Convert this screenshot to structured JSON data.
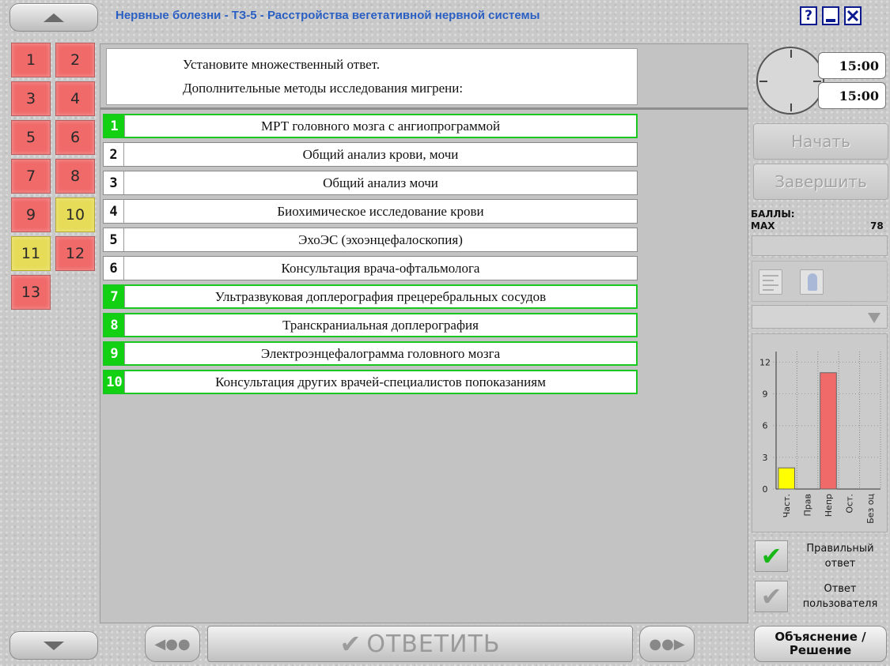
{
  "title": "Нервные болезни - ТЗ-5 - Расстройства вегетативной нервной системы",
  "window_controls": {
    "help": "?"
  },
  "questions": [
    {
      "label": "1",
      "status": "red"
    },
    {
      "label": "2",
      "status": "red"
    },
    {
      "label": "3",
      "status": "red"
    },
    {
      "label": "4",
      "status": "red"
    },
    {
      "label": "5",
      "status": "red"
    },
    {
      "label": "6",
      "status": "red"
    },
    {
      "label": "7",
      "status": "red"
    },
    {
      "label": "8",
      "status": "red"
    },
    {
      "label": "9",
      "status": "red"
    },
    {
      "label": "10",
      "status": "yellow"
    },
    {
      "label": "11",
      "status": "yellow"
    },
    {
      "label": "12",
      "status": "red"
    },
    {
      "label": "13",
      "status": "red"
    }
  ],
  "question": {
    "line1": "Установите множественный ответ.",
    "line2": "Дополнительные методы исследования мигрени:"
  },
  "answers": [
    {
      "num": "1",
      "text": "МРТ головного мозга с ангиопрограммой",
      "selected": true
    },
    {
      "num": "2",
      "text": "Общий анализ крови, мочи",
      "selected": false
    },
    {
      "num": "3",
      "text": "Общий анализ мочи",
      "selected": false
    },
    {
      "num": "4",
      "text": "Биохимическое исследование крови",
      "selected": false
    },
    {
      "num": "5",
      "text": "ЭхоЭС (эхоэнцефалоскопия)",
      "selected": false
    },
    {
      "num": "6",
      "text": "Консультация врача-офтальмолога",
      "selected": false
    },
    {
      "num": "7",
      "text": "Ультразвуковая доплерография прецеребральных сосудов",
      "selected": true
    },
    {
      "num": "8",
      "text": "Транскраниальная доплерография",
      "selected": true
    },
    {
      "num": "9",
      "text": "Электроэнцефалограмма головного мозга",
      "selected": true
    },
    {
      "num": "10",
      "text": "Консультация других врачей-специалистов попоказаниям",
      "selected": true
    }
  ],
  "timer": {
    "total": "15:00",
    "remaining": "15:00"
  },
  "buttons": {
    "start": "Начать",
    "finish": "Завершить",
    "answer": "ОТВЕТИТЬ",
    "explain_line1": "Объяснение /",
    "explain_line2": "Решение"
  },
  "score": {
    "label": "БАЛЛЫ:",
    "max_label": "MAX",
    "max_value": "78"
  },
  "legend": {
    "correct_line1": "Правильный",
    "correct_line2": "ответ",
    "user_line1": "Ответ",
    "user_line2": "пользователя"
  },
  "colors": {
    "answered_red": "#f06a6a",
    "partial_yellow": "#e6dc58",
    "selected_green": "#12d012",
    "title_blue": "#2a5fc4"
  },
  "chart_data": {
    "type": "bar",
    "categories": [
      "Част.",
      "Прав",
      "Непр",
      "Ост.",
      "Без оц"
    ],
    "values": [
      2,
      0,
      11,
      0,
      0
    ],
    "colors": [
      "#ffff00",
      "#d0d0d0",
      "#f06a6a",
      "#d0d0d0",
      "#d0d0d0"
    ],
    "yticks": [
      0,
      3,
      6,
      9,
      12
    ],
    "ylim": [
      0,
      13
    ],
    "grid": true
  }
}
